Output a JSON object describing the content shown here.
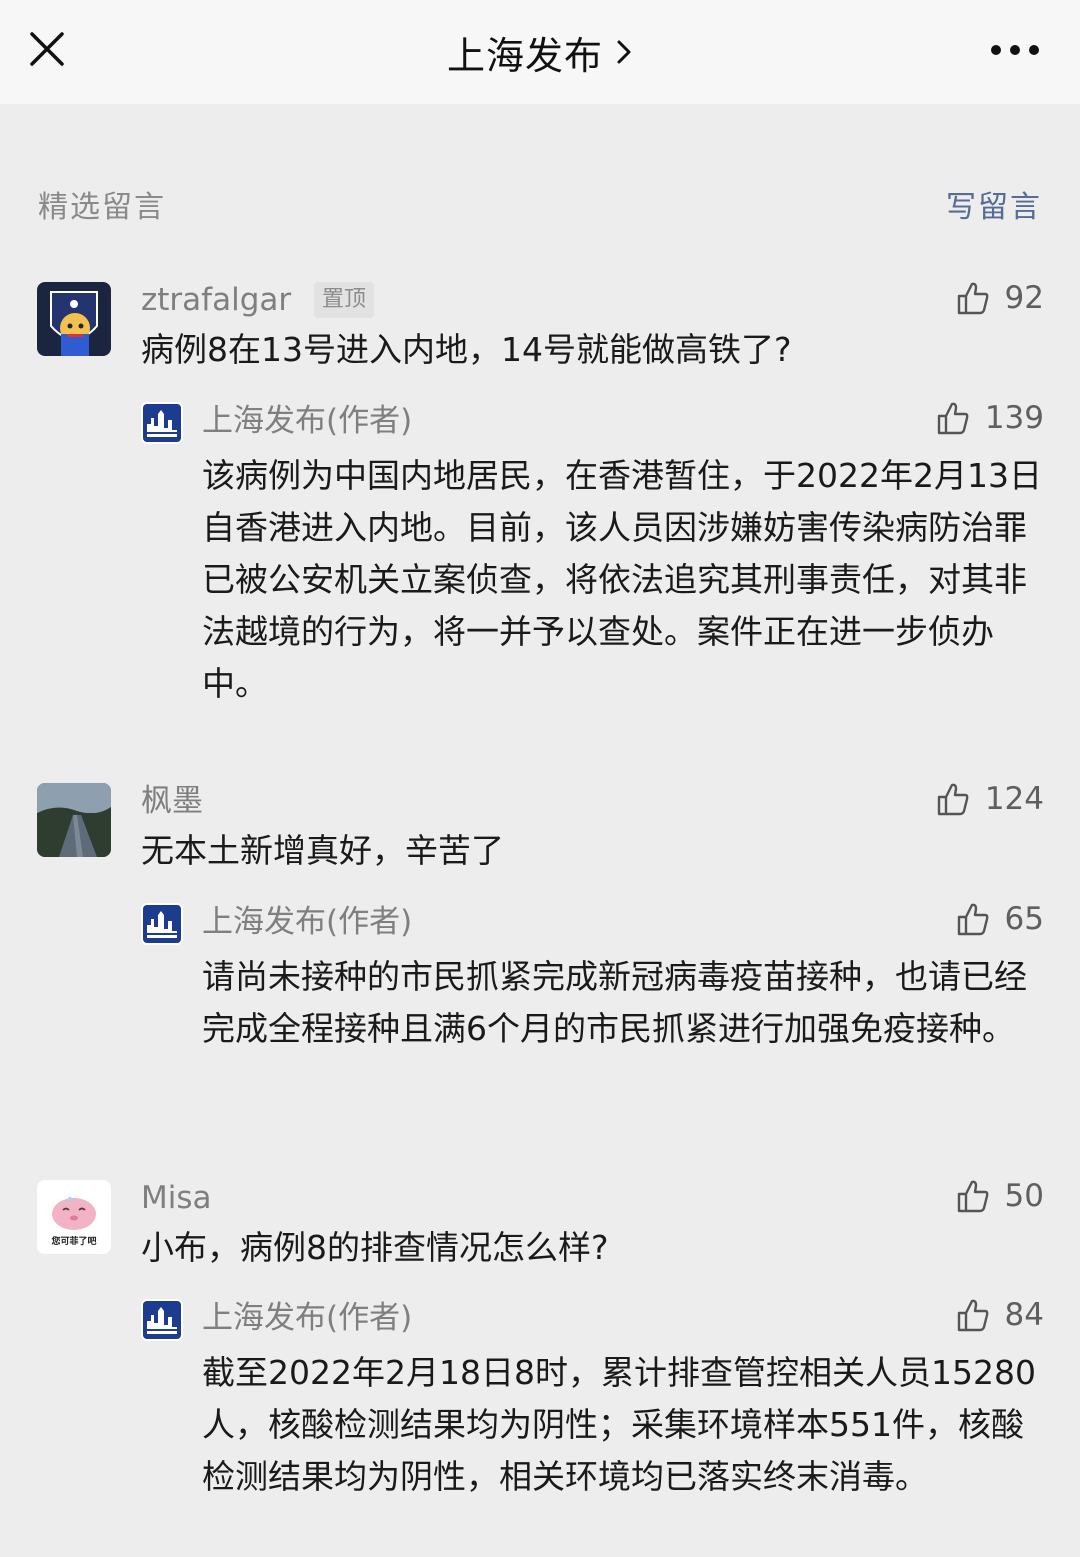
{
  "header": {
    "title": "上海发布",
    "close_icon": "close-icon",
    "chevron_icon": "chevron-right-icon",
    "more_icon": "more-dots-icon"
  },
  "section": {
    "title": "精选留言",
    "write_label": "写留言",
    "accent_color": "#576b95"
  },
  "comments": [
    {
      "author": "ztrafalgar",
      "badge": "置顶",
      "likes": "92",
      "text": "病例8在13号进入内地，14号就能做高铁了?",
      "reply": {
        "author": "上海发布(作者)",
        "likes": "139",
        "text": "该病例为中国内地居民，在香港暂住，于2022年2月13日自香港进入内地。目前，该人员因涉嫌妨害传染病防治罪已被公安机关立案侦查，将依法追究其刑事责任，对其非法越境的行为，将一并予以查处。案件正在进一步侦办中。"
      }
    },
    {
      "author": "枫墨",
      "likes": "124",
      "text": "无本土新增真好，辛苦了",
      "reply": {
        "author": "上海发布(作者)",
        "likes": "65",
        "text": "请尚未接种的市民抓紧完成新冠病毒疫苗接种，也请已经完成全程接种且满6个月的市民抓紧进行加强免疫接种。"
      }
    },
    {
      "author": "Misa",
      "avatar_caption": "您可菲了吧",
      "likes": "50",
      "text": "小布，病例8的排查情况怎么样?",
      "reply": {
        "author": "上海发布(作者)",
        "likes": "84",
        "text": "截至2022年2月18日8时，累计排查管控相关人员15280人，核酸检测结果均为阴性；采集环境样本551件，核酸检测结果均为阴性，相关环境均已落实终末消毒。"
      }
    }
  ]
}
